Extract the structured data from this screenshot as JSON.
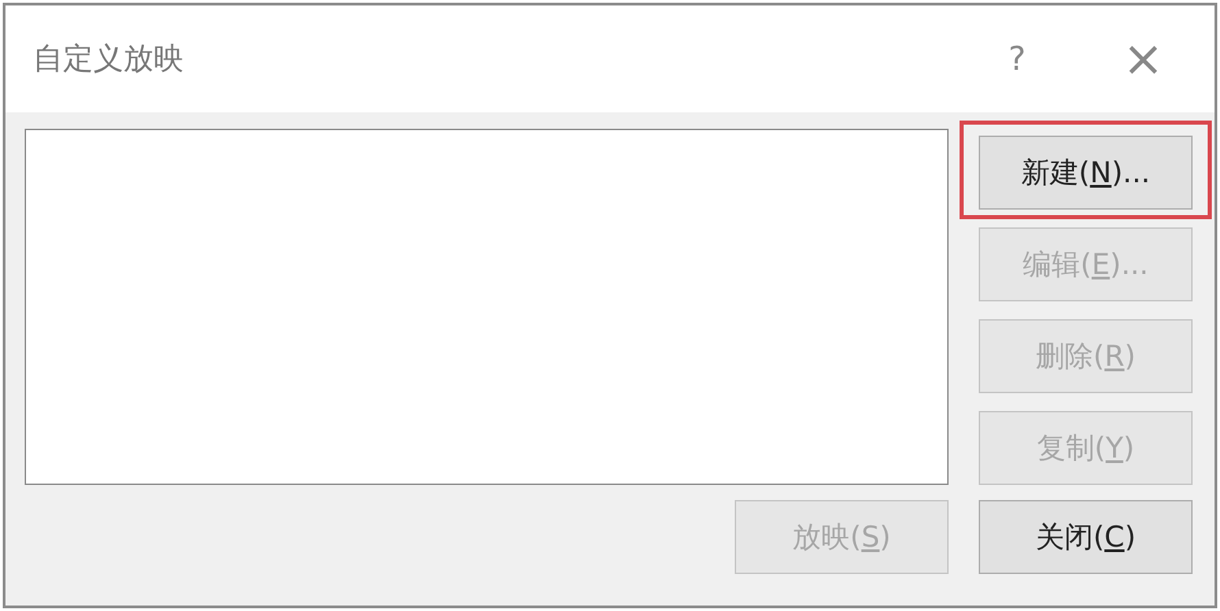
{
  "window": {
    "title": "自定义放映",
    "help": "?",
    "close": "×"
  },
  "side_buttons": [
    {
      "text": "新建(",
      "access_key": "N",
      "after": ")...",
      "disabled": false,
      "highlighted": true
    },
    {
      "text": "编辑(",
      "access_key": "E",
      "after": ")...",
      "disabled": true,
      "highlighted": false
    },
    {
      "text": "删除(",
      "access_key": "R",
      "after": ")",
      "disabled": true,
      "highlighted": false
    },
    {
      "text": "复制(",
      "access_key": "Y",
      "after": ")",
      "disabled": true,
      "highlighted": false
    }
  ],
  "bottom_buttons": [
    {
      "text": "放映(",
      "access_key": "S",
      "after": ")",
      "disabled": true,
      "highlighted": false
    },
    {
      "text": "关闭(",
      "access_key": "C",
      "after": ")",
      "disabled": false,
      "highlighted": false
    }
  ]
}
